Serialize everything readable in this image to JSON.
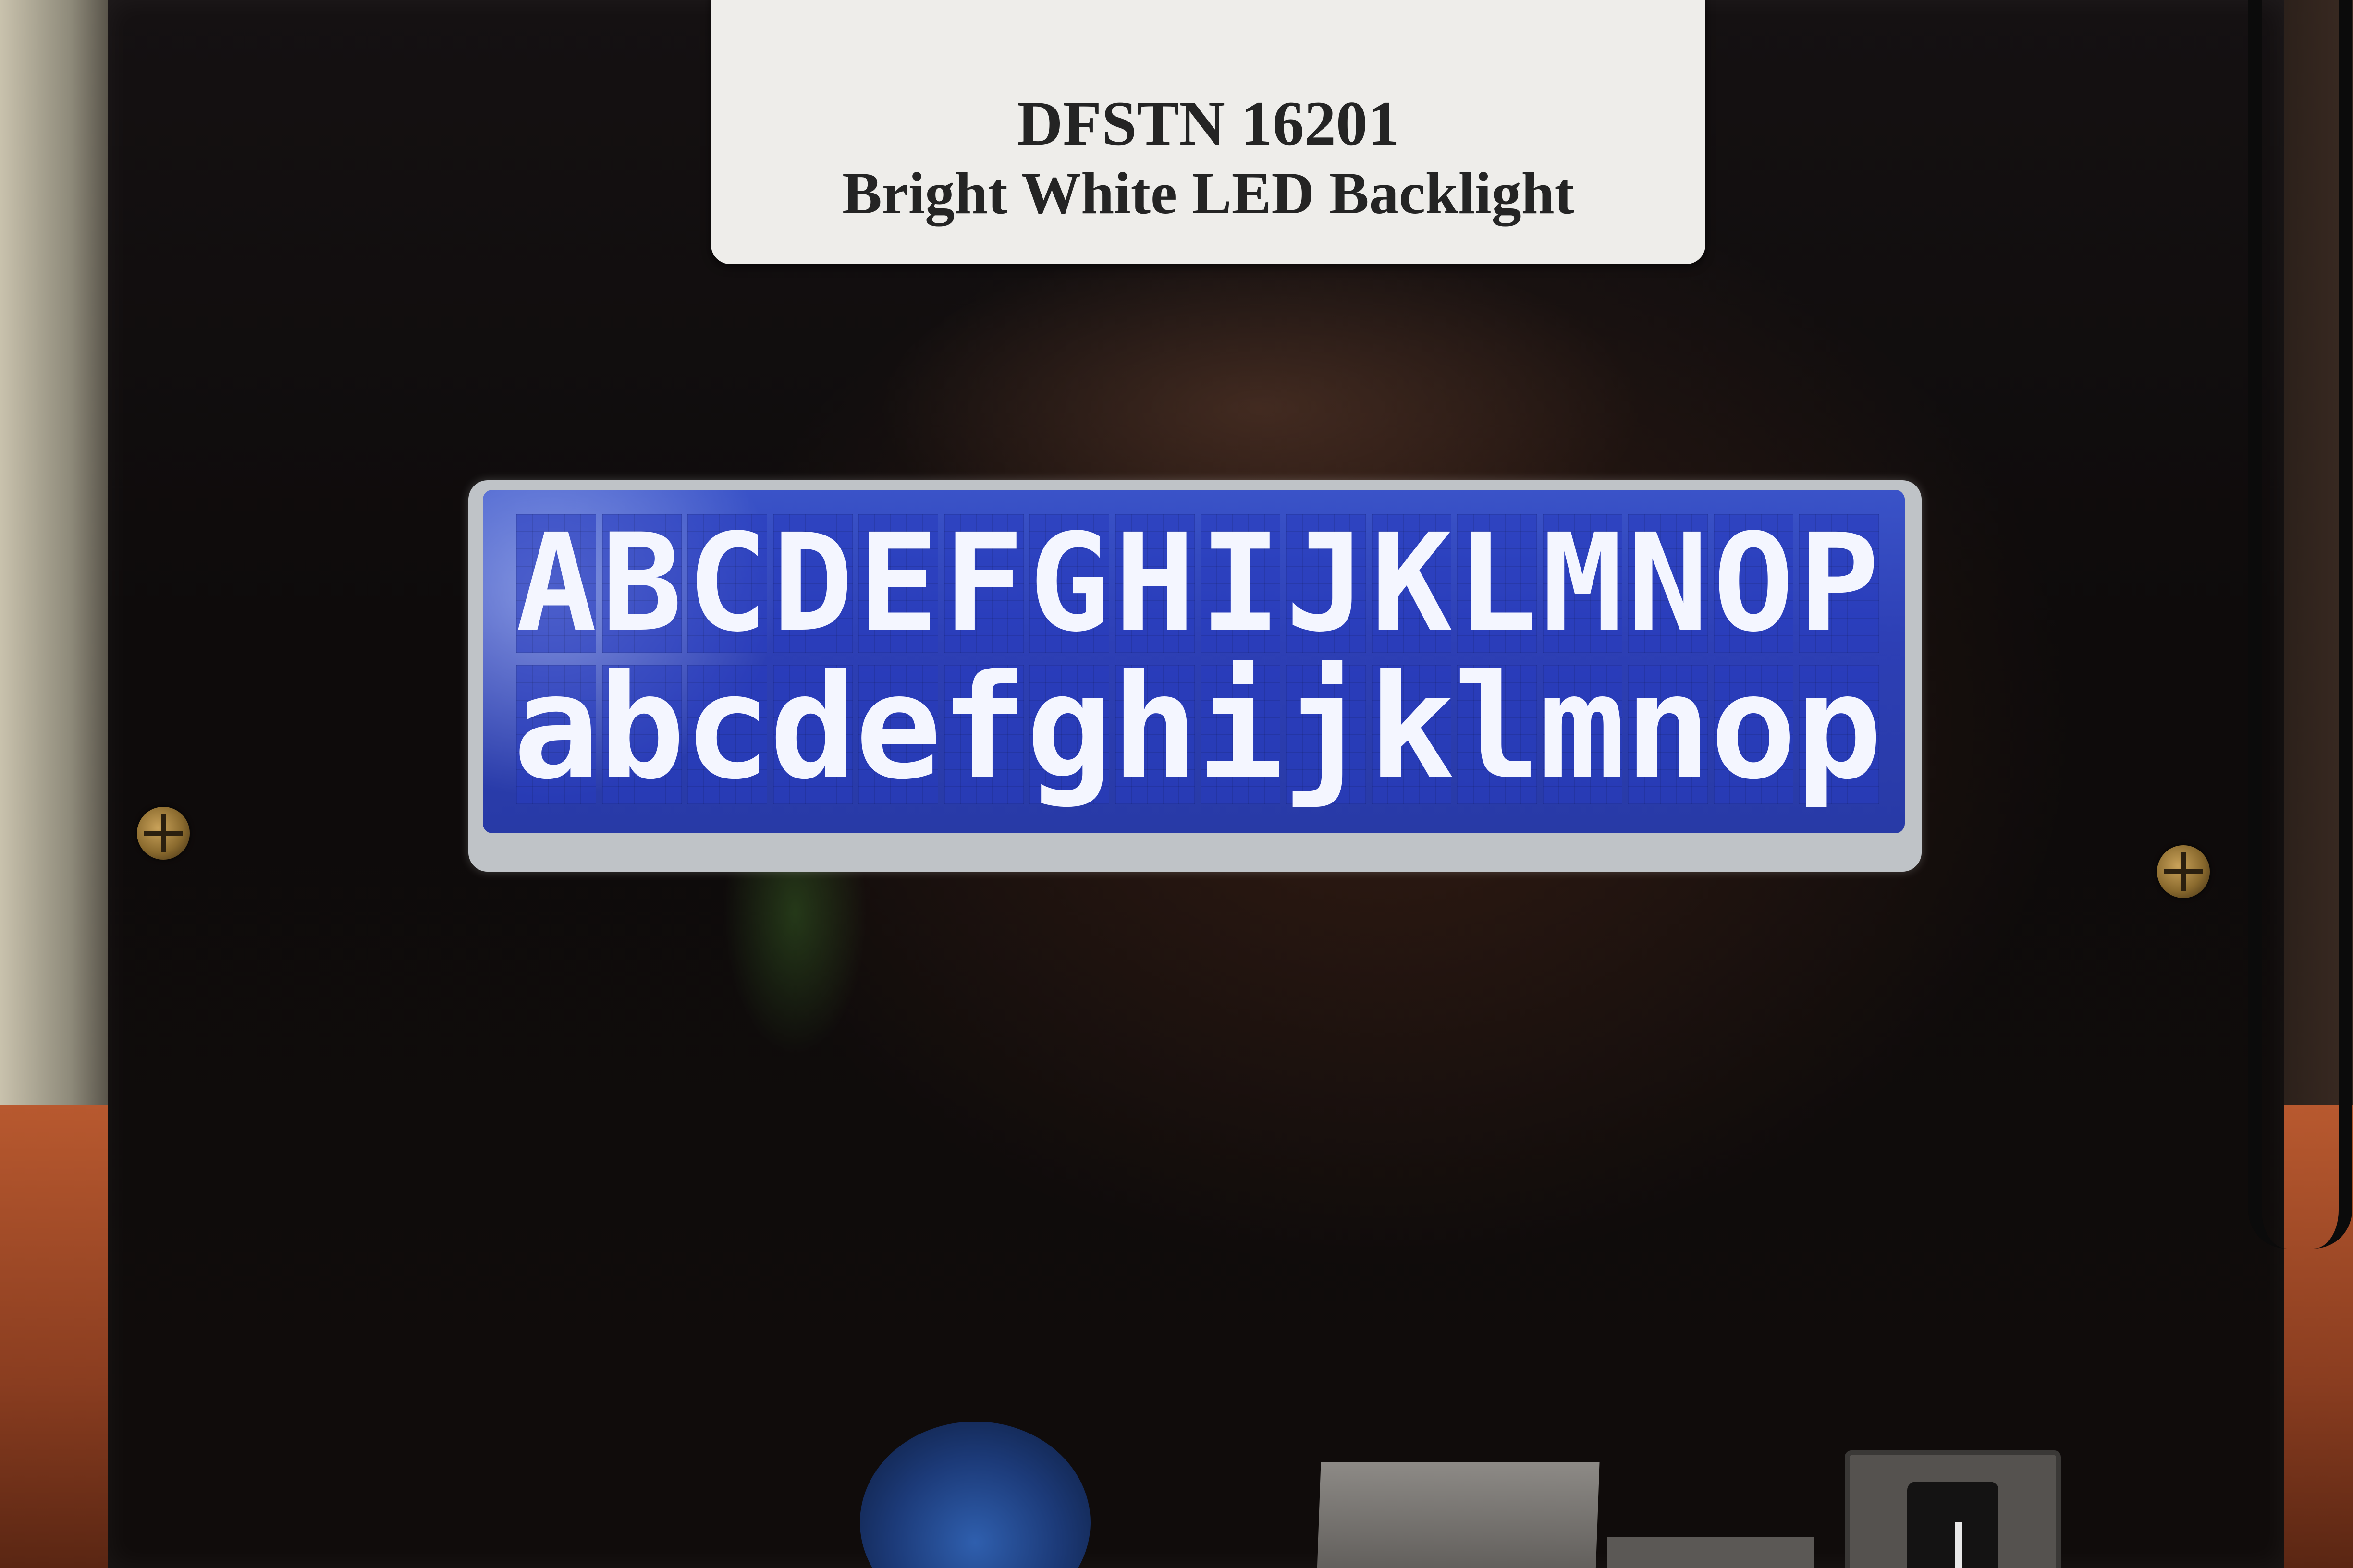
{
  "label": {
    "line1": "DFSTN 16201",
    "line2": "Bright White LED Backlight"
  },
  "lcd": {
    "row1": [
      "A",
      "B",
      "C",
      "D",
      "E",
      "F",
      "G",
      "H",
      "I",
      "J",
      "K",
      "L",
      "M",
      "N",
      "O",
      "P"
    ],
    "row2": [
      "a",
      "b",
      "c",
      "d",
      "e",
      "f",
      "g",
      "h",
      "i",
      "j",
      "k",
      "l",
      "m",
      "n",
      "o",
      "p"
    ]
  },
  "colors": {
    "lcd_background": "#2d3fb5",
    "lcd_text": "#f4f6ff",
    "label_background": "#eeedea",
    "panel": "#100c0b"
  }
}
